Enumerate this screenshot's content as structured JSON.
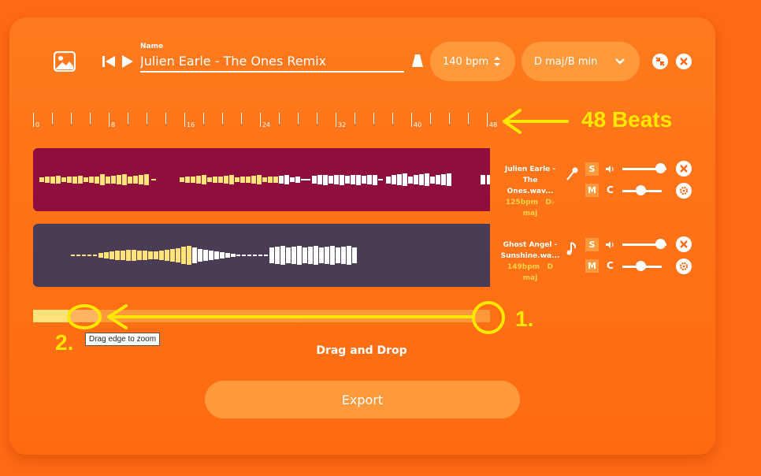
{
  "header": {
    "name_label": "Name",
    "track_name": "Julien Earle - The Ones Remix",
    "bpm": "140 bpm",
    "key": "D maj/B min"
  },
  "ruler": {
    "labels": [
      "0",
      "8",
      "16",
      "24",
      "32",
      "40",
      "48"
    ]
  },
  "annotations": {
    "beats": "48 Beats",
    "one": "1.",
    "two": "2."
  },
  "tracks": [
    {
      "title": "Julien Earle - The Ones.wav...",
      "bpm": "125bpm",
      "key": "D♭ maj",
      "solo_label": "S",
      "mute_label": "M",
      "c_label": "C",
      "volume": 0.85,
      "pitch": 0.45,
      "color": "#8e0e3e",
      "icon": "microphone-icon"
    },
    {
      "title": "Ghost Angel - Sunshine.wa...",
      "bpm": "149bpm",
      "key": "D maj",
      "solo_label": "S",
      "mute_label": "M",
      "c_label": "C",
      "volume": 0.85,
      "pitch": 0.45,
      "color": "#4b3c55",
      "icon": "music-note-icon"
    }
  ],
  "zoom": {
    "tooltip": "Drag edge to zoom"
  },
  "drag_and_drop": "Drag and Drop",
  "export_label": "Export",
  "colors": {
    "background": "#ff6a14",
    "accent": "#ff9a3c",
    "annotation": "#ffe800",
    "wave_played": "#ffe37a",
    "wave_unplayed": "#ffffff"
  }
}
